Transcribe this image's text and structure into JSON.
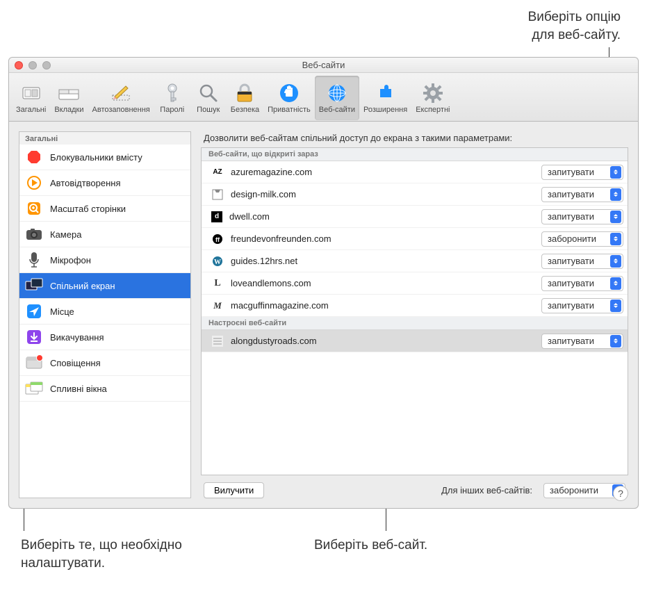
{
  "callouts": {
    "top_right_line1": "Виберіть опцію",
    "top_right_line2": "для веб-сайту.",
    "bottom_left_line1": "Виберіть те, що необхідно",
    "bottom_left_line2": "налаштувати.",
    "bottom_right": "Виберіть веб-сайт."
  },
  "window": {
    "title": "Веб-сайти"
  },
  "toolbar": {
    "items": [
      {
        "label": "Загальні"
      },
      {
        "label": "Вкладки"
      },
      {
        "label": "Автозаповнення"
      },
      {
        "label": "Паролі"
      },
      {
        "label": "Пошук"
      },
      {
        "label": "Безпека"
      },
      {
        "label": "Приватність"
      },
      {
        "label": "Веб-сайти"
      },
      {
        "label": "Розширення"
      },
      {
        "label": "Експертні"
      }
    ]
  },
  "sidebar": {
    "header": "Загальні",
    "items": [
      {
        "label": "Блокувальники вмісту"
      },
      {
        "label": "Автовідтворення"
      },
      {
        "label": "Масштаб сторінки"
      },
      {
        "label": "Камера"
      },
      {
        "label": "Мікрофон"
      },
      {
        "label": "Спільний екран"
      },
      {
        "label": "Місце"
      },
      {
        "label": "Викачування"
      },
      {
        "label": "Сповіщення"
      },
      {
        "label": "Спливні вікна"
      }
    ]
  },
  "main": {
    "heading": "Дозволити веб-сайтам спільний доступ до екрана з такими параметрами:",
    "section_open": "Веб-сайти, що відкриті зараз",
    "section_configured": "Настроєні веб-сайти",
    "open_sites": [
      {
        "domain": "azuremagazine.com",
        "option": "запитувати"
      },
      {
        "domain": "design-milk.com",
        "option": "запитувати"
      },
      {
        "domain": "dwell.com",
        "option": "запитувати"
      },
      {
        "domain": "freundevonfreunden.com",
        "option": "заборонити"
      },
      {
        "domain": "guides.12hrs.net",
        "option": "запитувати"
      },
      {
        "domain": "loveandlemons.com",
        "option": "запитувати"
      },
      {
        "domain": "macguffinmagazine.com",
        "option": "запитувати"
      }
    ],
    "configured_sites": [
      {
        "domain": "alongdustyroads.com",
        "option": "запитувати"
      }
    ],
    "remove_button": "Вилучити",
    "other_sites_label": "Для інших веб-сайтів:",
    "other_sites_option": "заборонити"
  },
  "help": "?"
}
